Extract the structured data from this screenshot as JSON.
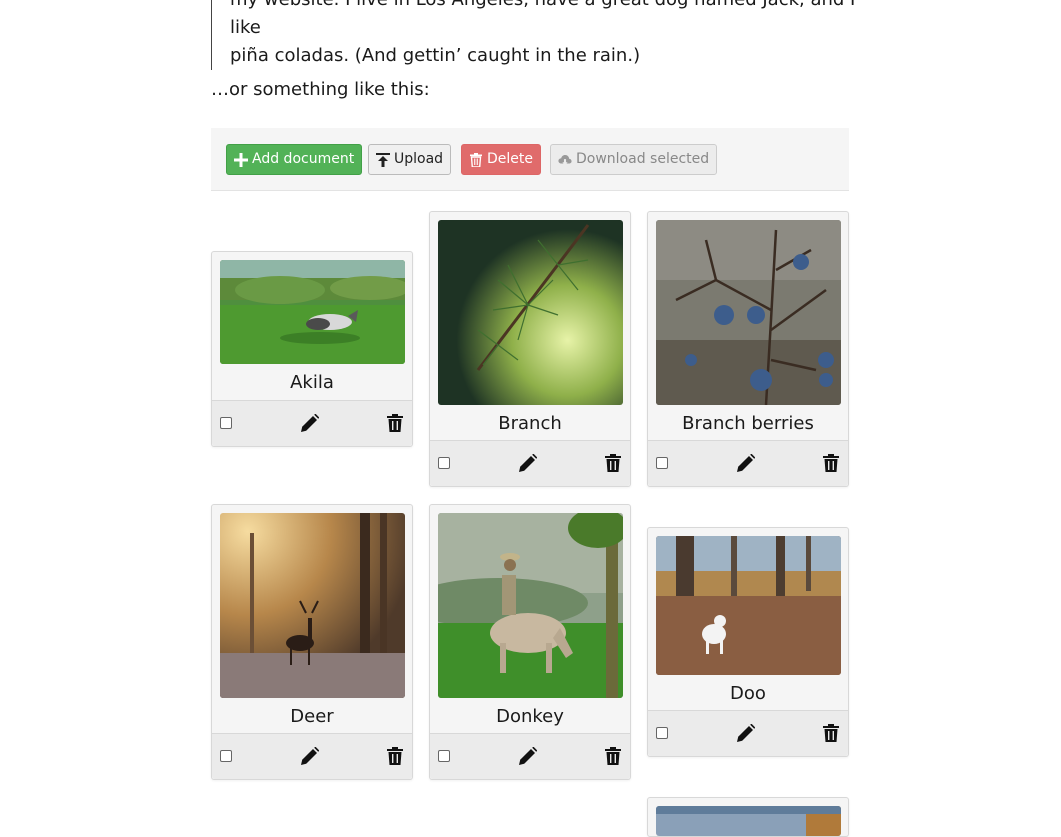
{
  "article": {
    "quote_line_1": "my website. I live in Los Angeles, have a great dog named Jack, and I like",
    "quote_line_2": "piña coladas. (And gettin’ caught in the rain.)",
    "lead": "…or something like this:"
  },
  "toolbar": {
    "add_label": "Add document",
    "upload_label": "Upload",
    "delete_label": "Delete",
    "download_label": "Download selected"
  },
  "documents": [
    {
      "name": "Akila"
    },
    {
      "name": "Branch"
    },
    {
      "name": "Branch berries"
    },
    {
      "name": "Deer"
    },
    {
      "name": "Donkey"
    },
    {
      "name": "Doo"
    }
  ],
  "colors": {
    "add_button": "#52b257",
    "delete_button": "#e06b6b",
    "card_background": "#f5f5f5",
    "actions_background": "#ebebeb"
  },
  "icons": [
    "plus-icon",
    "upload-icon",
    "trash-icon",
    "cloud-download-icon",
    "pencil-icon",
    "checkbox-icon"
  ]
}
